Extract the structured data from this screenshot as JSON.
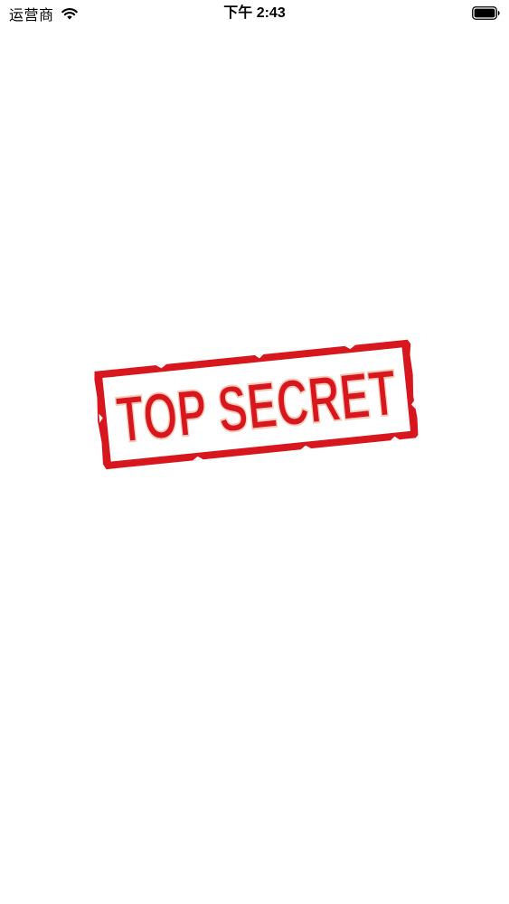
{
  "status_bar": {
    "carrier": "运营商",
    "time": "下午 2:43",
    "wifi_icon": "wifi-icon",
    "battery_icon": "battery-full-icon"
  },
  "stamp": {
    "text": "TOP SECRET",
    "icon": "top-secret-stamp",
    "colors": {
      "ink": "#d7161d",
      "paper": "#ffffff",
      "highlight": "#f7c9b8"
    }
  }
}
